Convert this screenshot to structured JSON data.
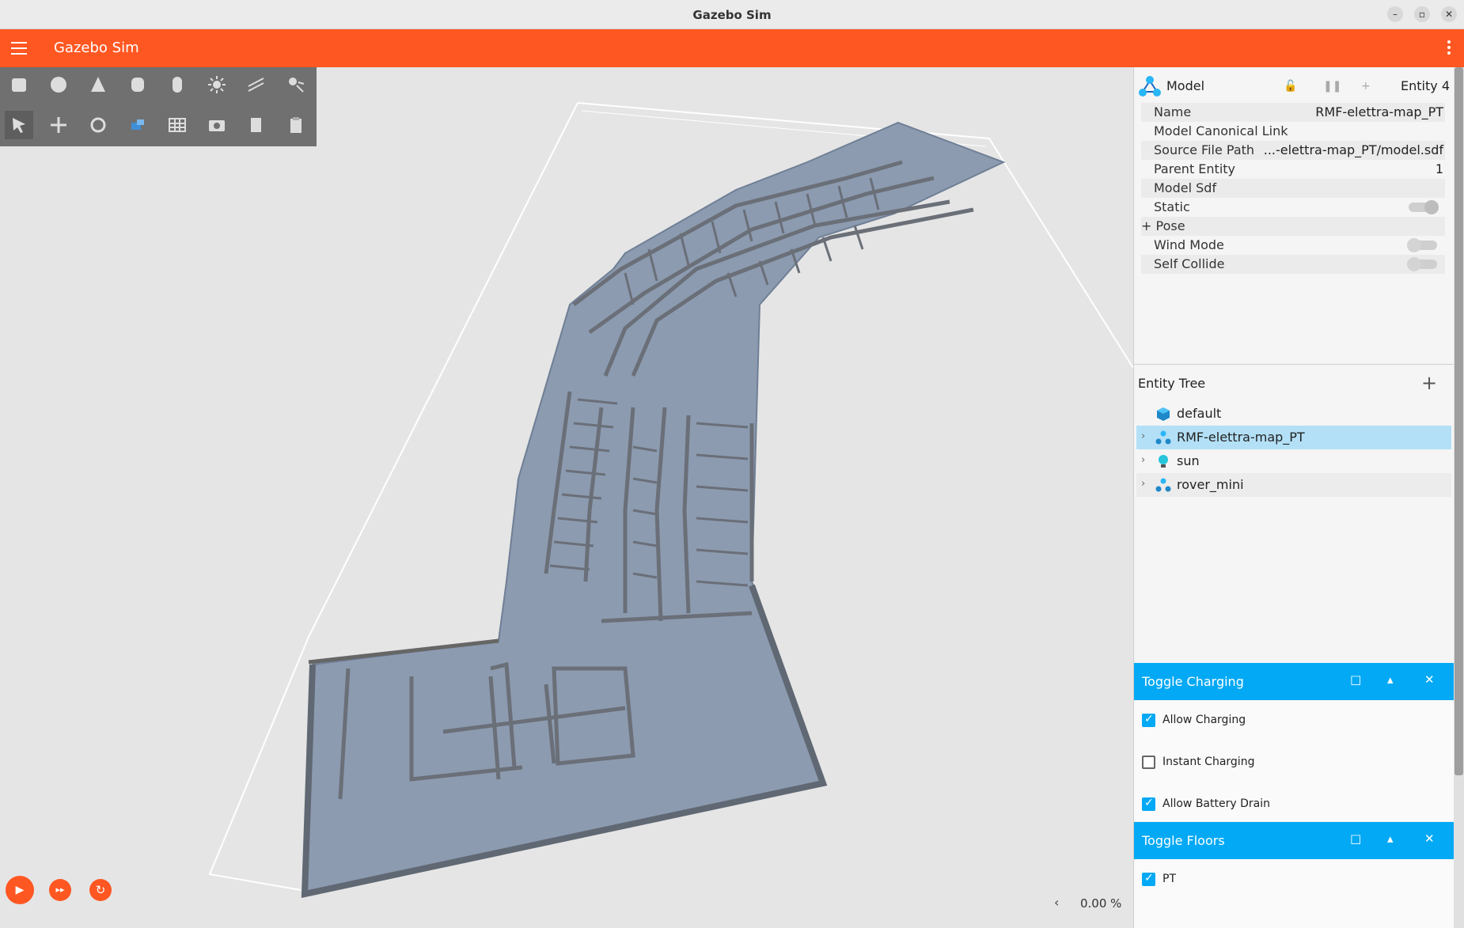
{
  "window": {
    "title": "Gazebo Sim",
    "minimize": "–",
    "restore": "▫",
    "close": "✕"
  },
  "appbar": {
    "title": "Gazebo Sim"
  },
  "toolbar": {
    "shapes": [
      "box-icon",
      "sphere-icon",
      "cone-icon",
      "cylinder-icon",
      "capsule-icon",
      "sun-light-icon",
      "directional-light-icon",
      "spot-light-icon"
    ],
    "tools": [
      "select-icon",
      "translate-icon",
      "rotate-icon",
      "transform-control-icon",
      "grid-icon",
      "screenshot-icon",
      "copy-icon",
      "paste-icon"
    ]
  },
  "playback": {
    "play": "▶",
    "step": "▸▸",
    "reset": "↻",
    "rtf": "0.00 %",
    "collapse": "‹"
  },
  "component_inspector": {
    "type_label": "Model",
    "entity_label": "Entity 4",
    "lock_icon": "🔓",
    "pause_icon": "❚❚",
    "add_icon": "+",
    "properties": [
      {
        "key": "Name",
        "value": "RMF-elettra-map_PT"
      },
      {
        "key": "Model Canonical Link",
        "value": ""
      },
      {
        "key": "Source File Path",
        "value": "...-elettra-map_PT/model.sdf"
      },
      {
        "key": "Parent Entity",
        "value": "1"
      },
      {
        "key": "Model Sdf",
        "value": ""
      },
      {
        "key": "Static",
        "value": ""
      },
      {
        "key": "+ Pose",
        "value": ""
      },
      {
        "key": "Wind Mode",
        "value": ""
      },
      {
        "key": "Self Collide",
        "value": ""
      }
    ]
  },
  "entity_tree": {
    "title": "Entity Tree",
    "add": "+",
    "items": [
      {
        "name": "default",
        "icon": "world-cube-icon"
      },
      {
        "name": "RMF-elettra-map_PT",
        "icon": "model-icon"
      },
      {
        "name": "sun",
        "icon": "light-bulb-icon"
      },
      {
        "name": "rover_mini",
        "icon": "model-icon"
      }
    ]
  },
  "toggle_charging": {
    "title": "Toggle Charging",
    "options": [
      {
        "label": "Allow Charging",
        "checked": true
      },
      {
        "label": "Instant Charging",
        "checked": false
      },
      {
        "label": "Allow Battery Drain",
        "checked": true
      }
    ]
  },
  "toggle_floors": {
    "title": "Toggle Floors",
    "options": [
      {
        "label": "PT",
        "checked": true
      }
    ]
  },
  "plugin_buttons": {
    "maximize": "□",
    "collapse": "▴",
    "close": "✕"
  },
  "colors": {
    "accent": "#ff5722",
    "plugin_header": "#03a9f4",
    "selection": "#b3e0f7",
    "map_floor": "#8c9bb0"
  }
}
